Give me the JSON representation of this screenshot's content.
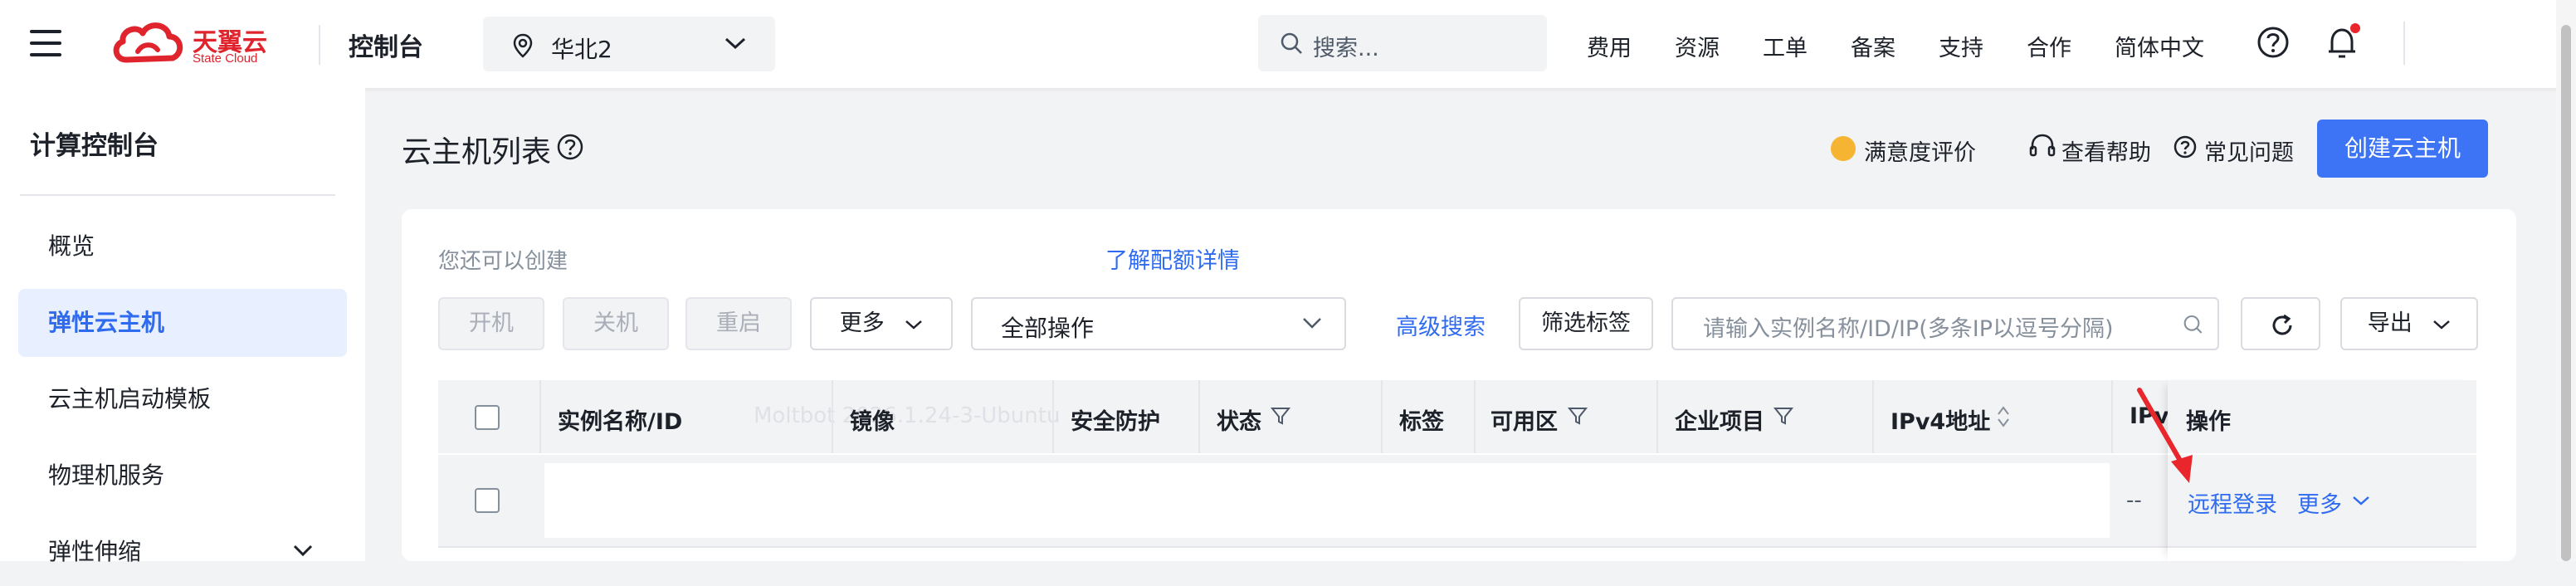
{
  "header": {
    "logo_cn": "天翼云",
    "logo_en": "State Cloud",
    "console_title": "控制台",
    "region": "华北2",
    "search_placeholder": "搜索...",
    "nav": [
      "费用",
      "资源",
      "工单",
      "备案",
      "支持",
      "合作",
      "简体中文"
    ]
  },
  "sidebar": {
    "title": "计算控制台",
    "items": [
      {
        "label": "概览",
        "active": false
      },
      {
        "label": "弹性云主机",
        "active": true
      },
      {
        "label": "云主机启动模板",
        "active": false
      },
      {
        "label": "物理机服务",
        "active": false
      },
      {
        "label": "弹性伸缩",
        "active": false
      }
    ]
  },
  "page": {
    "title": "云主机列表",
    "links": [
      "满意度评价",
      "查看帮助",
      "常见问题"
    ],
    "create_button": "创建云主机"
  },
  "toolbar": {
    "can_create": "您还可以创建",
    "quota_link": "了解配额详情",
    "start": "开机",
    "stop": "关机",
    "restart": "重启",
    "more": "更多",
    "all_ops": "全部操作",
    "advanced_search": "高级搜索",
    "filter_tags": "筛选标签",
    "search_placeholder": "请输入实例名称/ID/IP(多条IP以逗号分隔)",
    "export": "导出"
  },
  "table": {
    "columns": [
      "实例名称/ID",
      "镜像",
      "安全防护",
      "状态",
      "标签",
      "可用区",
      "企业项目",
      "IPv4地址",
      "IPv",
      "操作"
    ],
    "ghost_text": "Moltbot 2026.1.24-3-Ubuntu",
    "row": {
      "ipv6": "--",
      "remote_login": "远程登录",
      "more": "更多"
    }
  },
  "colors": {
    "accent": "#3d73f5",
    "link": "#2f6bf0",
    "brand_red": "#e0242d",
    "arrow_red": "#e8262b"
  }
}
